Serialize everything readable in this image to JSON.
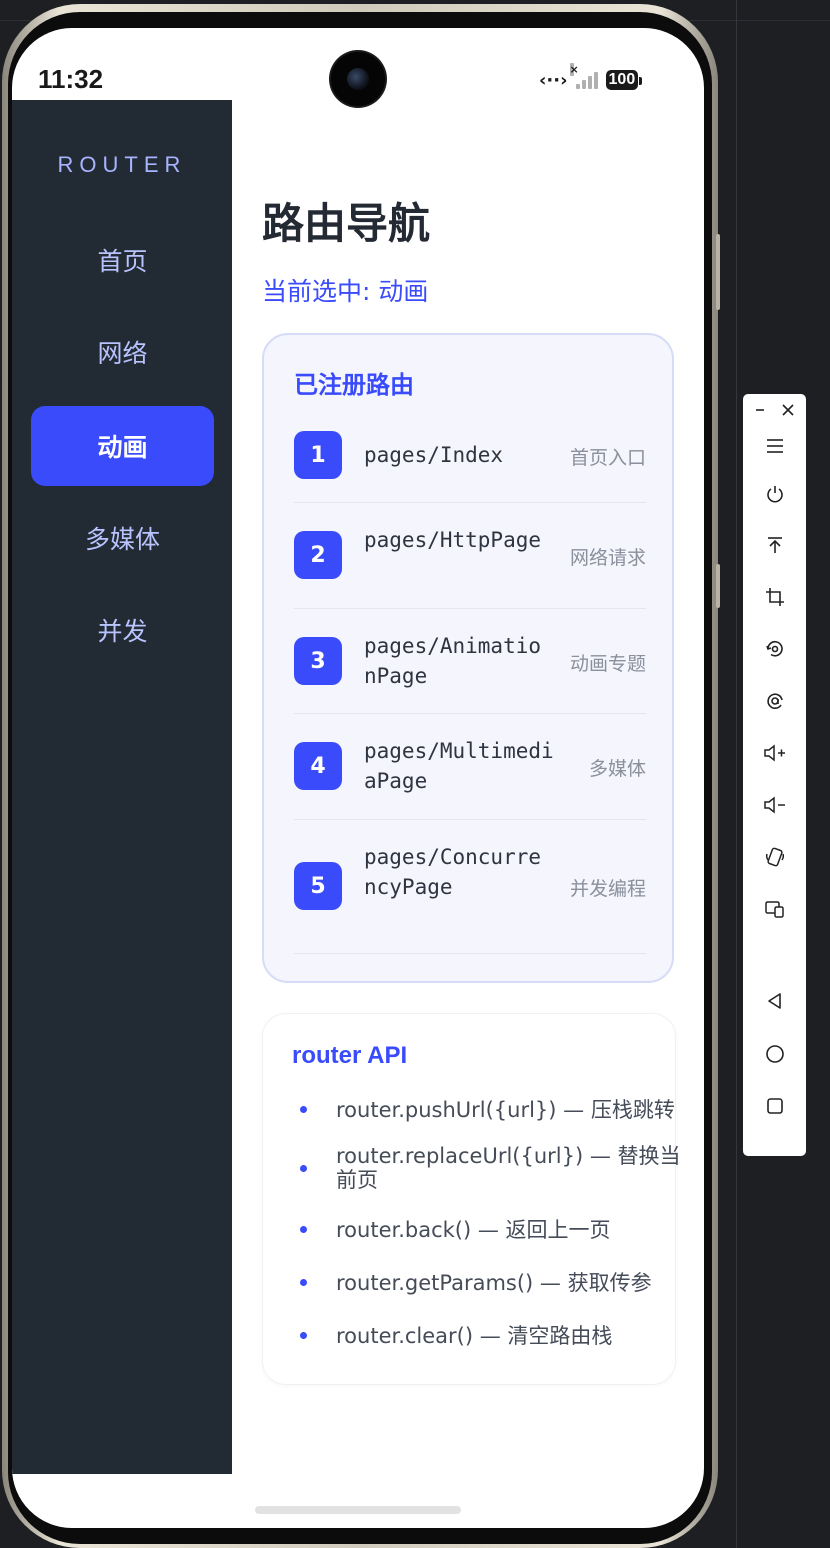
{
  "status_bar": {
    "time": "11:32",
    "network_icon": "data-transfer-icon",
    "battery": "100"
  },
  "sidebar": {
    "brand": "ROUTER",
    "items": [
      {
        "label": "首页",
        "active": false
      },
      {
        "label": "网络",
        "active": false
      },
      {
        "label": "动画",
        "active": true
      },
      {
        "label": "多媒体",
        "active": false
      },
      {
        "label": "并发",
        "active": false
      }
    ]
  },
  "main": {
    "title": "路由导航",
    "current_selection": "当前选中: 动画",
    "routes_card": {
      "title": "已注册路由",
      "routes": [
        {
          "num": "1",
          "path": "pages/Index",
          "desc": "首页入口"
        },
        {
          "num": "2",
          "path": "pages/HttpPage",
          "desc": "网络请求"
        },
        {
          "num": "3",
          "path": "pages/AnimationPage",
          "desc": "动画专题"
        },
        {
          "num": "4",
          "path": "pages/MultimediaPage",
          "desc": "多媒体"
        },
        {
          "num": "5",
          "path": "pages/ConcurrencyPage",
          "desc": "并发编程"
        }
      ]
    },
    "api_card": {
      "title": "router API",
      "items": [
        "router.pushUrl({url}) — 压栈跳转",
        "router.replaceUrl({url}) — 替换当前页",
        "router.back() — 返回上一页",
        "router.getParams() — 获取传参",
        "router.clear() — 清空路由栈"
      ]
    }
  },
  "emulator_toolbar": {
    "buttons": [
      "menu-icon",
      "power-icon",
      "pin-top-icon",
      "crop-icon",
      "rotate-icon",
      "screenshot-icon",
      "volume-up-icon",
      "volume-down-icon",
      "shake-icon",
      "multi-device-icon",
      "back-icon",
      "home-icon",
      "recents-icon"
    ]
  },
  "colors": {
    "accent": "#3a4bfb",
    "sidebar_bg": "#222a33",
    "sidebar_text": "#b9c4ff",
    "title_text": "#232a33",
    "muted": "#8a909c"
  }
}
